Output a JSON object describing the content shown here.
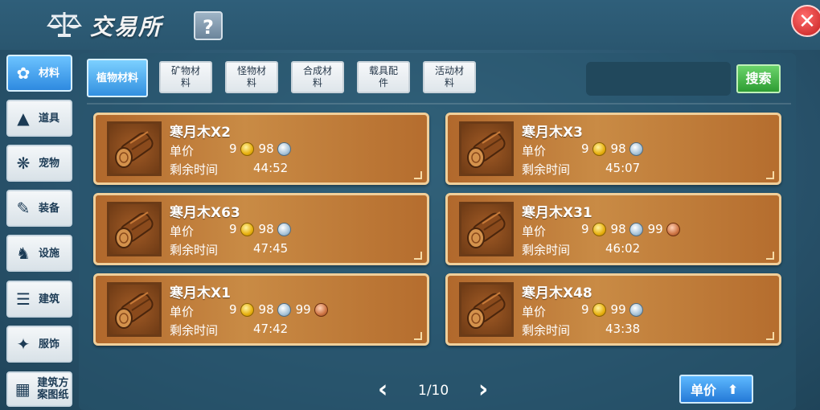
{
  "header": {
    "title": "交易所",
    "help_label": "?",
    "close_label": "✕"
  },
  "sidebar": {
    "items": [
      {
        "label": "材料",
        "icon": "materials-icon",
        "glyph": "✿",
        "active": true
      },
      {
        "label": "道具",
        "icon": "potion-icon",
        "glyph": "▲",
        "active": false
      },
      {
        "label": "宠物",
        "icon": "paw-icon",
        "glyph": "❋",
        "active": false
      },
      {
        "label": "装备",
        "icon": "equipment-icon",
        "glyph": "✎",
        "active": false
      },
      {
        "label": "设施",
        "icon": "facility-icon",
        "glyph": "♞",
        "active": false
      },
      {
        "label": "建筑",
        "icon": "building-icon",
        "glyph": "☰",
        "active": false
      },
      {
        "label": "服饰",
        "icon": "clothing-icon",
        "glyph": "✦",
        "active": false
      },
      {
        "label": "建筑方案图纸",
        "icon": "blueprint-icon",
        "glyph": "▦",
        "active": false
      }
    ]
  },
  "tabs": [
    {
      "label": "植物材料",
      "active": true
    },
    {
      "label": "矿物材料",
      "active": false
    },
    {
      "label": "怪物材料",
      "active": false
    },
    {
      "label": "合成材料",
      "active": false
    },
    {
      "label": "载具配件",
      "active": false
    },
    {
      "label": "活动材料",
      "active": false
    }
  ],
  "search": {
    "button_label": "搜索",
    "value": ""
  },
  "listing_labels": {
    "price": "单价",
    "time": "剩余时间"
  },
  "listings": [
    {
      "name": "寒月木X2",
      "gold": "9",
      "silver": "98",
      "copper": "",
      "time": "44:52"
    },
    {
      "name": "寒月木X3",
      "gold": "9",
      "silver": "98",
      "copper": "",
      "time": "45:07"
    },
    {
      "name": "寒月木X63",
      "gold": "9",
      "silver": "98",
      "copper": "",
      "time": "47:45"
    },
    {
      "name": "寒月木X31",
      "gold": "9",
      "silver": "98",
      "copper": "99",
      "time": "46:02"
    },
    {
      "name": "寒月木X1",
      "gold": "9",
      "silver": "98",
      "copper": "99",
      "time": "47:42"
    },
    {
      "name": "寒月木X48",
      "gold": "9",
      "silver": "99",
      "copper": "",
      "time": "43:38"
    }
  ],
  "pagination": {
    "prev": "‹",
    "next": "›",
    "page_text": "1/10"
  },
  "sort": {
    "label": "单价",
    "arrow": "⬆"
  },
  "colors": {
    "accent": "#2e8ae0",
    "card": "#c98b45",
    "search_btn": "#2e9d33"
  }
}
